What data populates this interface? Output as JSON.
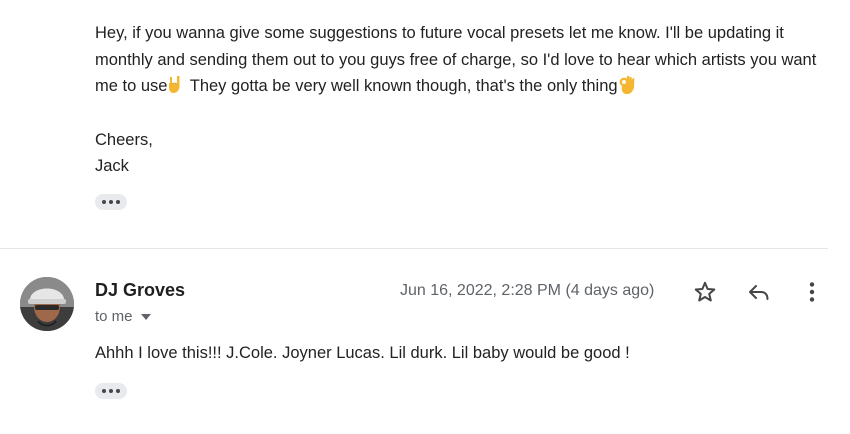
{
  "message1": {
    "body_part1": "Hey, if you wanna give some suggestions to future vocal presets let me know. I'll be updating it monthly and sending them out to you guys free of charge, so I'd love to hear which artists you want me to use",
    "emoji1": "🤘",
    "body_part2": " They gotta be very well known though, that's the only thing",
    "emoji2": "👌",
    "signoff_line1": "Cheers,",
    "signoff_line2": "Jack"
  },
  "message2": {
    "sender": "DJ Groves",
    "recipient": "to me",
    "date": "Jun 16, 2022, 2:28 PM (4 days ago)",
    "body": "Ahhh I love this!!! J.Cole. Joyner Lucas. Lil durk. Lil baby would be good !"
  },
  "icons": {
    "star": "star-icon",
    "reply": "reply-icon",
    "more": "more-vert-icon",
    "expand": "more-horiz-icon",
    "recipient_caret": "caret-down-icon"
  }
}
